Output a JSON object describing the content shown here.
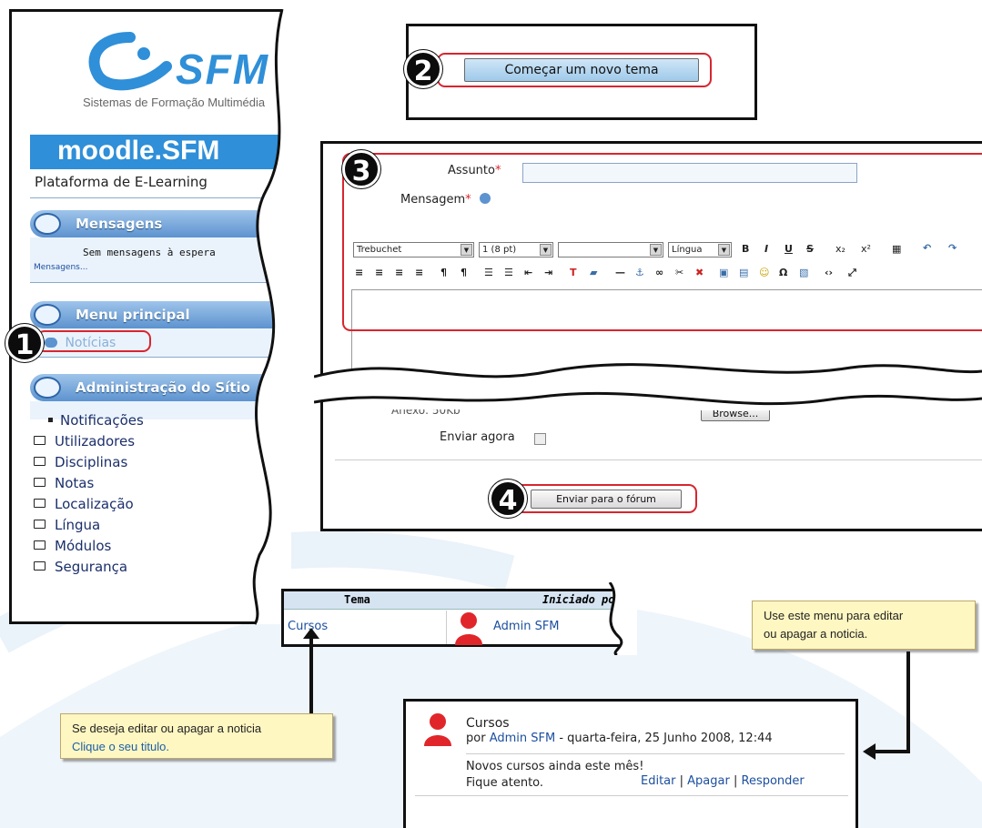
{
  "sidebar": {
    "logo_text": "SFM",
    "logo_subtitle": "Sistemas de Formação Multimédia",
    "moodle_banner": "moodle.SFM",
    "platform_label": "Plataforma de E-Learning",
    "messages": {
      "title": "Mensagens",
      "empty_text": "Sem mensagens à espera",
      "link": "Mensagens..."
    },
    "main_menu": {
      "title": "Menu principal",
      "item": "Notícias"
    },
    "admin": {
      "title": "Administração do Sítio",
      "items": [
        "Notificações",
        "Utilizadores",
        "Disciplinas",
        "Notas",
        "Localização",
        "Língua",
        "Módulos",
        "Segurança"
      ]
    }
  },
  "steps": [
    "1",
    "2",
    "3",
    "4"
  ],
  "new_topic_button": "Começar um novo tema",
  "form": {
    "subject_label": "Assunto",
    "message_label": "Mensagem",
    "required_mark": "*",
    "font_select": "Trebuchet",
    "size_select": "1 (8 pt)",
    "lang_select": "Língua",
    "attachment_text": "Anexo: 50Kb",
    "browse_button": "Browse...",
    "send_now_label": "Enviar agora",
    "submit_button": "Enviar para o fórum"
  },
  "topics_table": {
    "headers": [
      "Tema",
      "Iniciado por"
    ],
    "row": {
      "topic": "Cursos",
      "author": "Admin SFM"
    }
  },
  "notes": {
    "edit_menu": {
      "line1": "Use este menu para editar",
      "line2": "ou apagar a noticia."
    },
    "click_title": {
      "line1": "Se deseja editar ou apagar a noticia",
      "line2": "Clique o seu titulo."
    }
  },
  "post": {
    "title": "Cursos",
    "by_prefix": "por",
    "author": "Admin SFM",
    "date": "- quarta-feira, 25 Junho 2008, 12:44",
    "body_line1": "Novos cursos ainda este mês!",
    "body_line2": "Fique atento.",
    "actions": [
      "Editar",
      "Apagar",
      "Responder"
    ]
  },
  "colors": {
    "accent": "#d8252f",
    "link": "#1c4fa0",
    "brand": "#2f8fd8",
    "note_bg": "#fff7c2"
  }
}
